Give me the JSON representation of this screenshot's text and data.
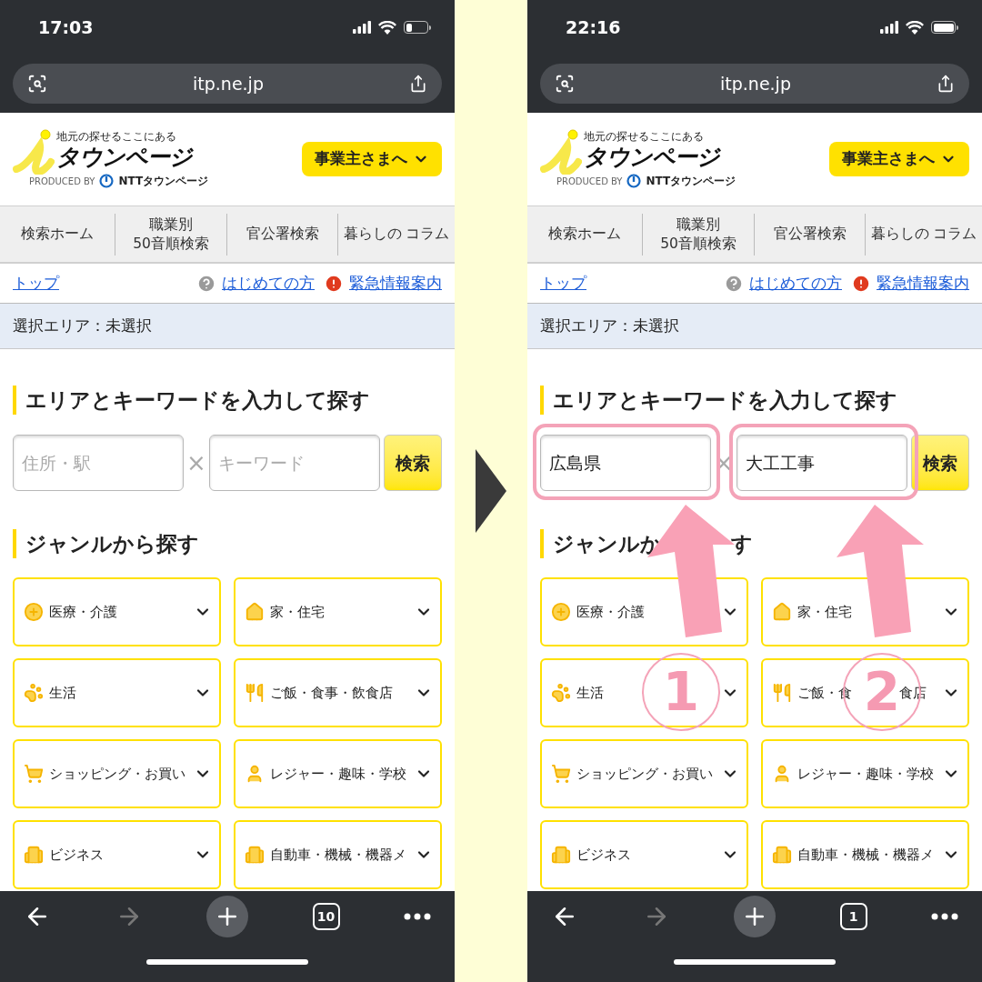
{
  "phones": [
    {
      "time": "17:03",
      "battery_low": true,
      "url": "itp.ne.jp",
      "logo": {
        "tagline": "地元の探せるここにある",
        "name": "タウンページ",
        "produced_by": "PRODUCED BY",
        "company": "NTTタウンページ"
      },
      "business_button": "事業主さまへ",
      "nav": [
        {
          "lines": [
            "検索ホーム"
          ]
        },
        {
          "lines": [
            "職業別",
            "50音順検索"
          ]
        },
        {
          "lines": [
            "官公署検索"
          ]
        },
        {
          "lines": [
            "暮らしの コラム"
          ]
        }
      ],
      "breadcrumb": "トップ",
      "links": [
        {
          "kind": "help",
          "label": "はじめての方"
        },
        {
          "kind": "alert",
          "label": "緊急情報案内"
        }
      ],
      "area": "選択エリア：未選択",
      "search_heading": "エリアとキーワードを入力して探す",
      "area_field": {
        "placeholder": "住所・駅"
      },
      "separator": "×",
      "keyword_field": {
        "placeholder": "キーワード"
      },
      "search_button": "検索",
      "genre_heading": [
        "ジャンルから探す"
      ],
      "genres": [
        {
          "label": "医療・介護"
        },
        {
          "label": "家・住宅"
        },
        {
          "label": "生活"
        },
        {
          "label": "ご飯・食事・飲食店"
        },
        {
          "label": "ショッピング・お買い"
        },
        {
          "label": "レジャー・趣味・学校"
        },
        {
          "label": "ビジネス"
        },
        {
          "label": "自動車・機械・機器メ"
        }
      ],
      "tab_count": "10"
    },
    {
      "time": "22:16",
      "battery_low": false,
      "url": "itp.ne.jp",
      "logo": {
        "tagline": "地元の探せるここにある",
        "name": "タウンページ",
        "produced_by": "PRODUCED BY",
        "company": "NTTタウンページ"
      },
      "business_button": "事業主さまへ",
      "nav": [
        {
          "lines": [
            "検索ホーム"
          ]
        },
        {
          "lines": [
            "職業別",
            "50音順検索"
          ]
        },
        {
          "lines": [
            "官公署検索"
          ]
        },
        {
          "lines": [
            "暮らしの コラム"
          ]
        }
      ],
      "breadcrumb": "トップ",
      "links": [
        {
          "kind": "help",
          "label": "はじめての方"
        },
        {
          "kind": "alert",
          "label": "緊急情報案内"
        }
      ],
      "area": "選択エリア：未選択",
      "search_heading": "エリアとキーワードを入力して探す",
      "area_field": {
        "value": "広島県"
      },
      "separator": "×",
      "keyword_field": {
        "value": "大工工事"
      },
      "search_button": "検索",
      "genre_heading": [
        "ジャンルか",
        "す"
      ],
      "genres": [
        {
          "label": "医療・介護"
        },
        {
          "label": "家・住宅"
        },
        {
          "label": "生活"
        },
        {
          "label_parts": [
            "ご飯・食",
            "食店"
          ]
        },
        {
          "label": "ショッピング・お買い"
        },
        {
          "label": "レジャー・趣味・学校"
        },
        {
          "label": "ビジネス"
        },
        {
          "label": "自動車・機械・機器メ"
        }
      ],
      "tab_count": "1",
      "annotations": [
        {
          "number": "1"
        },
        {
          "number": "2"
        }
      ]
    }
  ]
}
